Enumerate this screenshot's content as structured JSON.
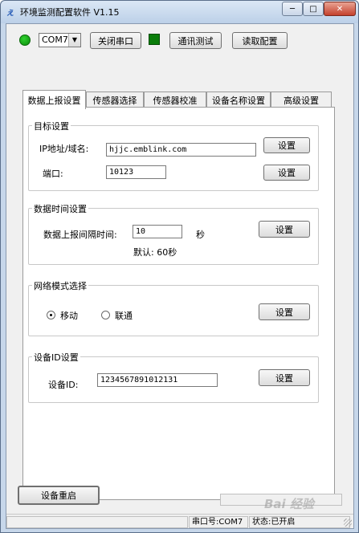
{
  "window": {
    "app_icon": "ぇ",
    "title": "环境监测配置软件 V1.15",
    "min_glyph": "─",
    "max_glyph": "□",
    "close_glyph": "✕"
  },
  "toolbar": {
    "port_value": "COM7",
    "close_port_label": "关闭串口",
    "comm_test_label": "通讯测试",
    "read_config_label": "读取配置",
    "status_color": "#0a7d0a"
  },
  "tabs": [
    {
      "label": "数据上报设置",
      "active": true
    },
    {
      "label": "传感器选择"
    },
    {
      "label": "传感器校准"
    },
    {
      "label": "设备名称设置"
    },
    {
      "label": "高级设置"
    }
  ],
  "target": {
    "title": "目标设置",
    "ip_label": "IP地址/域名:",
    "ip_value": "hjjc.emblink.com",
    "port_label": "端口:",
    "port_value": "10123",
    "set_label": "设置"
  },
  "timing": {
    "title": "数据时间设置",
    "interval_label": "数据上报间隔时间:",
    "interval_value": "10",
    "unit": "秒",
    "default_text": "默认: 60秒",
    "set_label": "设置"
  },
  "network": {
    "title": "网络模式选择",
    "option1": "移动",
    "option2": "联通",
    "selected": "移动",
    "set_label": "设置"
  },
  "device": {
    "title": "设备ID设置",
    "id_label": "设备ID:",
    "id_value": "1234567891012131",
    "set_label": "设置"
  },
  "bottom": {
    "restart_label": "设备重启"
  },
  "statusbar": {
    "port_text": "串口号:COM7",
    "state_text": "状态:已开启"
  },
  "watermark": "Bai 经验"
}
